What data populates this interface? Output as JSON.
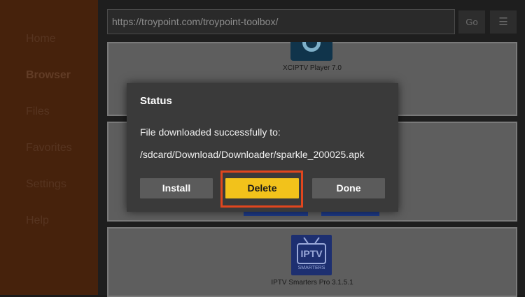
{
  "sidebar": {
    "items": [
      {
        "label": "Home"
      },
      {
        "label": "Browser"
      },
      {
        "label": "Files"
      },
      {
        "label": "Favorites"
      },
      {
        "label": "Settings"
      },
      {
        "label": "Help"
      }
    ],
    "active": "Browser"
  },
  "browser": {
    "url": "https://troypoint.com/troypoint-toolbox/",
    "go_label": "Go",
    "menu_icon": "☰"
  },
  "apps": [
    {
      "label": "XCIPTV Player 7.0",
      "icon": "xciptv-icon"
    },
    {
      "label": "IPTV Smarters Pro 3.1.5.1",
      "icon": "iptv-smarters-icon",
      "icon_text": "IPTV",
      "icon_subtext": "SMARTERS"
    }
  ],
  "dialog": {
    "title": "Status",
    "message": "File downloaded successfully to:",
    "path": "/sdcard/Download/Downloader/sparkle_200025.apk",
    "buttons": {
      "install": "Install",
      "delete": "Delete",
      "done": "Done"
    }
  },
  "colors": {
    "sidebar": "#5a2c10",
    "accent_yellow": "#f2c21b",
    "highlight": "#e0461e",
    "dialog_bg": "#3a3a3a"
  }
}
